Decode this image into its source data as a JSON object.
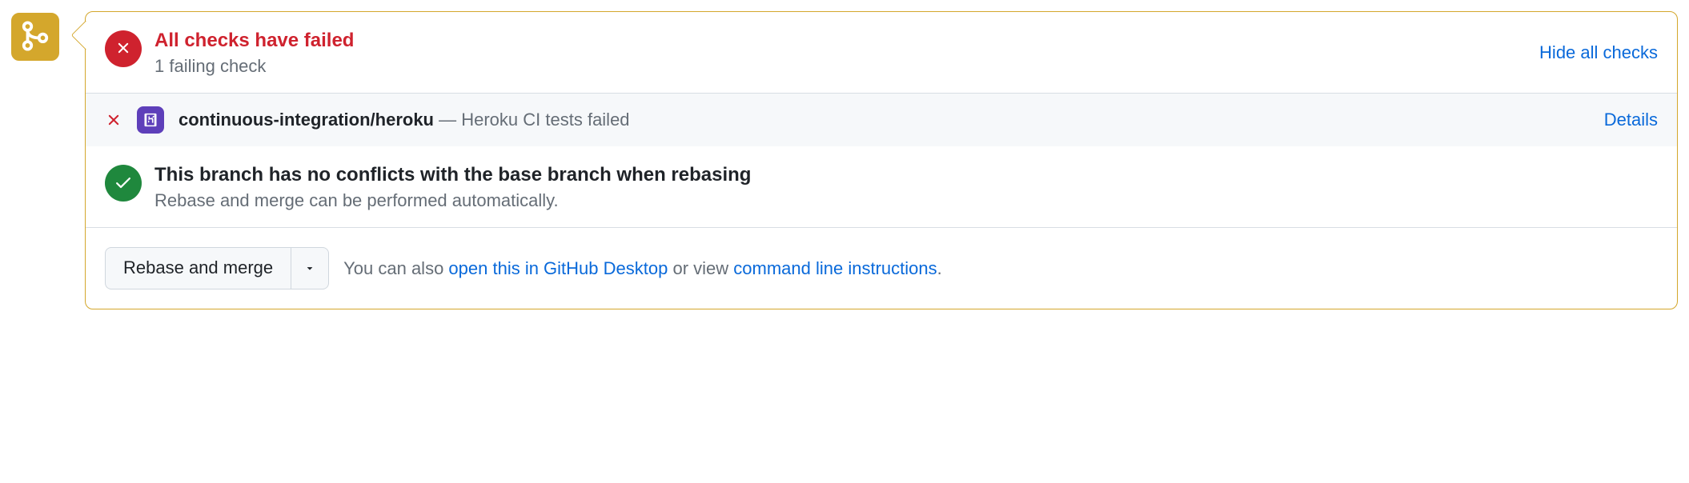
{
  "colors": {
    "accent_warning": "#d4a72c",
    "danger": "#cf222e",
    "success": "#1f883d",
    "link": "#0969da"
  },
  "checks_summary": {
    "title": "All checks have failed",
    "subtitle": "1 failing check",
    "hide_label": "Hide all checks"
  },
  "check_items": [
    {
      "status": "failed",
      "avatar_icon": "heroku-icon",
      "name": "continuous-integration/heroku",
      "separator": " — ",
      "description": "Heroku CI tests failed",
      "details_label": "Details"
    }
  ],
  "conflicts": {
    "title": "This branch has no conflicts with the base branch when rebasing",
    "subtitle": "Rebase and merge can be performed automatically."
  },
  "merge": {
    "button_label": "Rebase and merge",
    "help_prefix": "You can also ",
    "desktop_link": "open this in GitHub Desktop",
    "help_middle": " or view ",
    "cli_link": "command line instructions",
    "help_suffix": "."
  }
}
